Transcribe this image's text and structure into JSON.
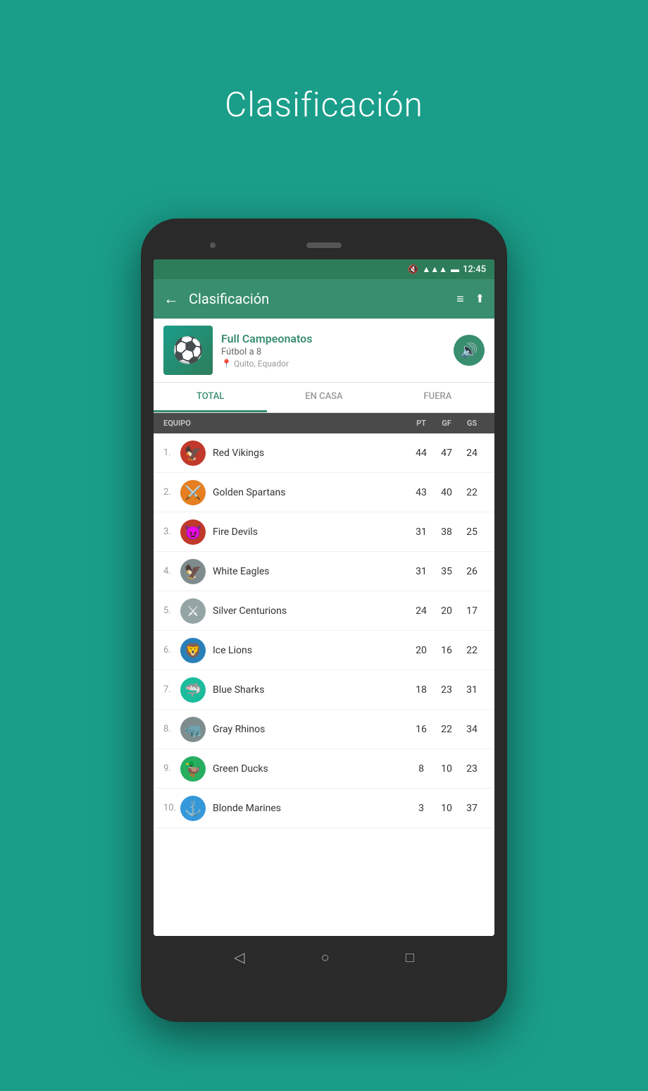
{
  "page": {
    "title": "Clasificación",
    "background": "#1a9e8a"
  },
  "status_bar": {
    "time": "12:45",
    "signal": "▲▲▲",
    "battery": "🔋"
  },
  "app_bar": {
    "back_label": "←",
    "title": "Clasificación",
    "list_icon": "≡",
    "share_icon": "⬆"
  },
  "league": {
    "name": "Full Campeonatos",
    "type": "Fútbol a 8",
    "location": "Quito, Equador",
    "audio_icon": "🔊"
  },
  "tabs": [
    {
      "id": "total",
      "label": "TOTAL",
      "active": true
    },
    {
      "id": "en-casa",
      "label": "EN CASA",
      "active": false
    },
    {
      "id": "fuera",
      "label": "FUERA",
      "active": false
    }
  ],
  "table": {
    "headers": {
      "team": "EQUIPO",
      "pt": "pt",
      "gf": "gf",
      "gs": "gs"
    },
    "rows": [
      {
        "rank": "1.",
        "name": "Red Vikings",
        "pt": 44,
        "gf": 47,
        "gs": 24,
        "logo": "🦅",
        "class": "logo-red-vikings"
      },
      {
        "rank": "2.",
        "name": "Golden Spartans",
        "pt": 43,
        "gf": 40,
        "gs": 22,
        "logo": "⚔️",
        "class": "logo-golden-spartans"
      },
      {
        "rank": "3.",
        "name": "Fire Devils",
        "pt": 31,
        "gf": 38,
        "gs": 25,
        "logo": "😈",
        "class": "logo-fire-devils"
      },
      {
        "rank": "4.",
        "name": "White Eagles",
        "pt": 31,
        "gf": 35,
        "gs": 26,
        "logo": "🦅",
        "class": "logo-white-eagles"
      },
      {
        "rank": "5.",
        "name": "Silver Centurions",
        "pt": 24,
        "gf": 20,
        "gs": 17,
        "logo": "⚔",
        "class": "logo-silver-centurions"
      },
      {
        "rank": "6.",
        "name": "Ice Lions",
        "pt": 20,
        "gf": 16,
        "gs": 22,
        "logo": "🦁",
        "class": "logo-ice-lions"
      },
      {
        "rank": "7.",
        "name": "Blue Sharks",
        "pt": 18,
        "gf": 23,
        "gs": 31,
        "logo": "🦈",
        "class": "logo-blue-sharks"
      },
      {
        "rank": "8.",
        "name": "Gray Rhinos",
        "pt": 16,
        "gf": 22,
        "gs": 34,
        "logo": "🦏",
        "class": "logo-gray-rhinos"
      },
      {
        "rank": "9.",
        "name": "Green Ducks",
        "pt": 8,
        "gf": 10,
        "gs": 23,
        "logo": "🦆",
        "class": "logo-green-ducks"
      },
      {
        "rank": "10.",
        "name": "Blonde Marines",
        "pt": 3,
        "gf": 10,
        "gs": 37,
        "logo": "⚓",
        "class": "logo-blonde-marines"
      }
    ]
  },
  "nav": {
    "back": "◁",
    "home": "○",
    "square": "□"
  }
}
